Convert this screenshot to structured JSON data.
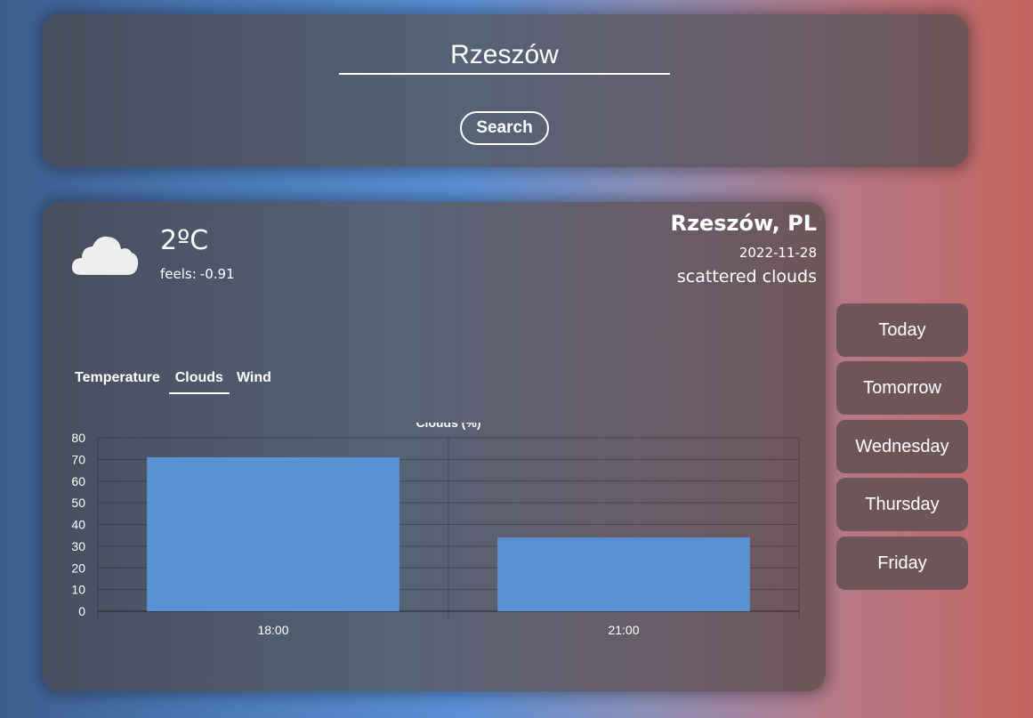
{
  "search": {
    "value": "Rzeszów",
    "button_label": "Search"
  },
  "current": {
    "icon": "cloud-icon",
    "temperature": "2ºC",
    "feels_label": "feels:",
    "feels_value": "-0.91",
    "city": "Rzeszów, PL",
    "date": "2022-11-28",
    "description": "scattered clouds"
  },
  "tabs": [
    {
      "label": "Temperature",
      "active": false
    },
    {
      "label": "Clouds",
      "active": true
    },
    {
      "label": "Wind",
      "active": false
    }
  ],
  "forecast_days": [
    "Today",
    "Tomorrow",
    "Wednesday",
    "Thursday",
    "Friday"
  ],
  "colors": {
    "bar": "#5a91d4"
  },
  "chart_data": {
    "type": "bar",
    "title": "Clouds (%)",
    "categories": [
      "18:00",
      "21:00"
    ],
    "values": [
      71,
      34
    ],
    "ylim": [
      0,
      80
    ],
    "yticks": [
      0,
      10,
      20,
      30,
      40,
      50,
      60,
      70,
      80
    ],
    "grid": true
  }
}
